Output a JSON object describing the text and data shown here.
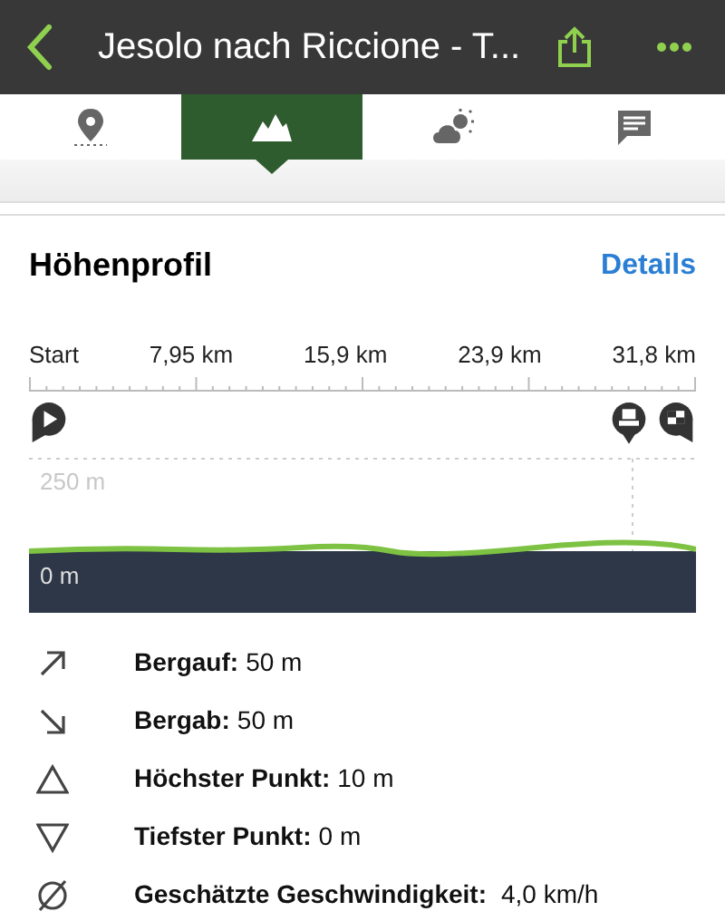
{
  "header": {
    "title": "Jesolo nach Riccione - T..."
  },
  "tabs": [
    {
      "kind": "pin",
      "selected": false
    },
    {
      "kind": "mountain",
      "selected": true
    },
    {
      "kind": "weather",
      "selected": false
    },
    {
      "kind": "comment",
      "selected": false
    }
  ],
  "section": {
    "title": "Höhenprofil",
    "link": "Details"
  },
  "profile": {
    "x_labels": [
      "Start",
      "7,95 km",
      "15,9 km",
      "23,9 km",
      "31,8 km"
    ],
    "y_labels": [
      "250 m",
      "0 m"
    ],
    "markers": [
      {
        "kind": "start"
      },
      {
        "kind": "ferry"
      },
      {
        "kind": "finish"
      }
    ]
  },
  "stats": [
    {
      "kind": "up",
      "label": "Bergauf:",
      "value": "50 m"
    },
    {
      "kind": "down",
      "label": "Bergab:",
      "value": "50 m"
    },
    {
      "kind": "highest",
      "label": "Höchster Punkt:",
      "value": "10 m"
    },
    {
      "kind": "lowest",
      "label": "Tiefster Punkt:",
      "value": "0 m"
    },
    {
      "kind": "speed",
      "label": "Geschätzte Geschwindigkeit:",
      "value": "4,0 km/h"
    }
  ]
}
